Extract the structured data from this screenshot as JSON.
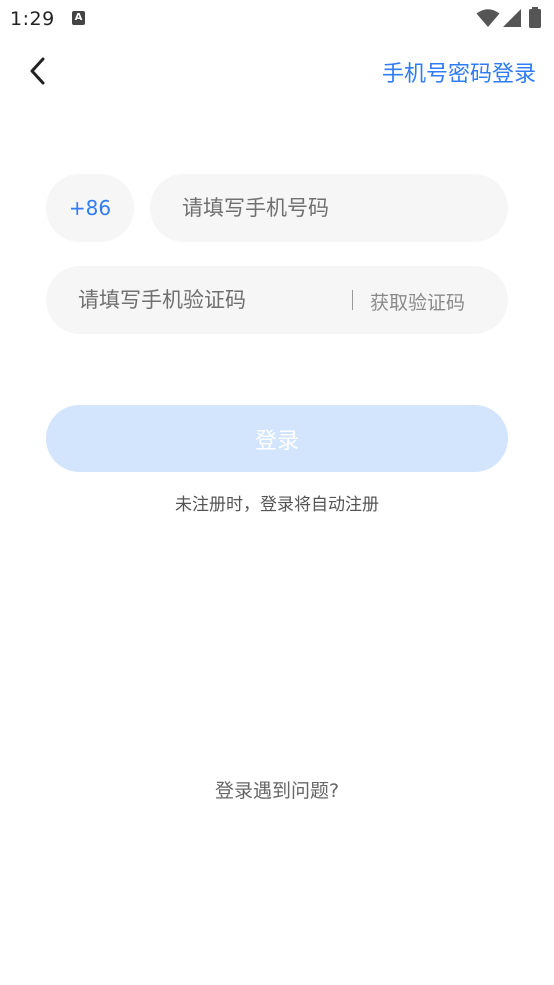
{
  "status_bar": {
    "time": "1:29",
    "notification_glyph": "A",
    "icons": [
      "wifi-icon",
      "signal-icon",
      "battery-icon"
    ]
  },
  "header": {
    "back_icon": "chevron-left-icon",
    "switch_login_label": "手机号密码登录"
  },
  "form": {
    "country_code": "+86",
    "phone_placeholder": "请填写手机号码",
    "phone_value": "",
    "code_placeholder": "请填写手机验证码",
    "code_value": "",
    "get_code_label": "获取验证码",
    "login_label": "登录",
    "register_hint": "未注册时，登录将自动注册"
  },
  "footer": {
    "help_label": "登录遇到问题?"
  },
  "colors": {
    "accent": "#2f7cf6",
    "button_disabled": "#d2e5fd",
    "field_bg": "#f6f6f6"
  }
}
